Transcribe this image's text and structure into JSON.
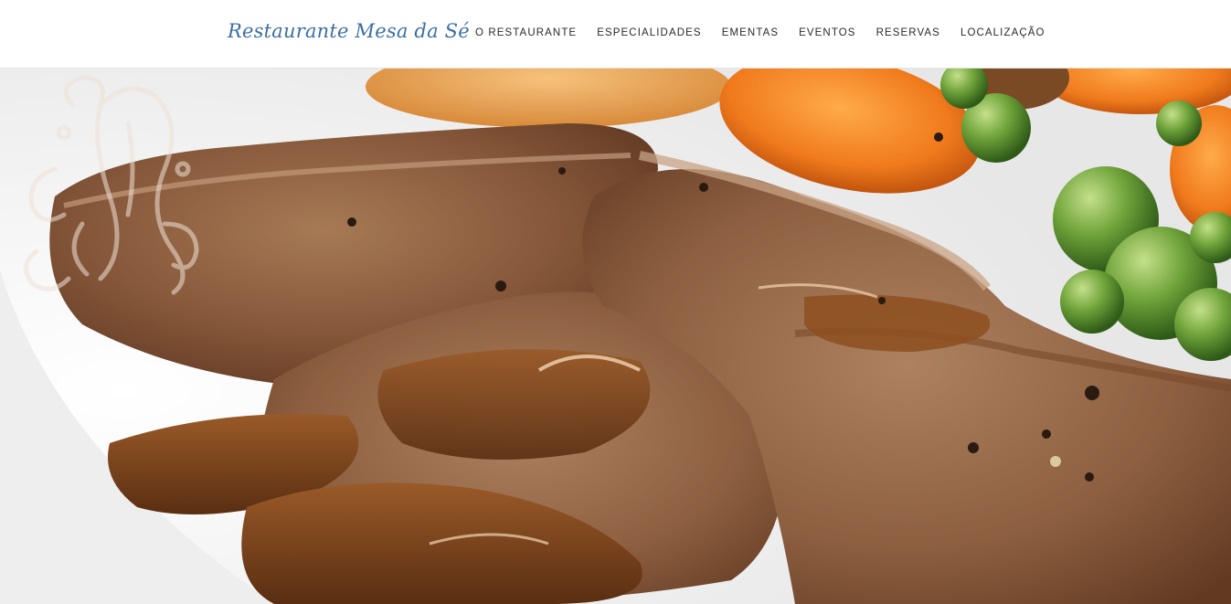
{
  "header": {
    "brand": "Restaurante Mesa da Sé",
    "nav": [
      {
        "label": "O RESTAURANTE"
      },
      {
        "label": "ESPECIALIDADES"
      },
      {
        "label": "EMENTAS"
      },
      {
        "label": "EVENTOS"
      },
      {
        "label": "RESERVAS"
      },
      {
        "label": "LOCALIZAÇÃO"
      }
    ]
  },
  "hero": {
    "image": "roast-beef-with-gravy-carrots-peas-photo",
    "watermark": "MS-monogram-icon"
  },
  "colors": {
    "brand": "#3b6fa3",
    "nav_text": "#2a2a2a",
    "header_bg": "#ffffff"
  }
}
